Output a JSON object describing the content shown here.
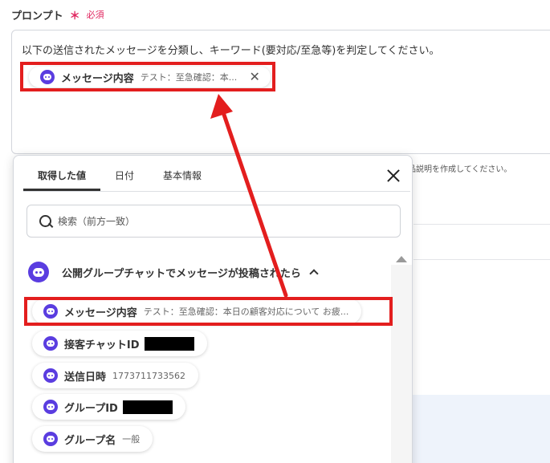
{
  "field": {
    "label": "プロンプト",
    "required_mark": "＊",
    "required_text": "必須",
    "prompt_text": "以下の送信されたメッセージを分類し、キーワード(要対応/至急等)を判定してください。",
    "inserted_chip": {
      "icon": "chat-bubble-icon",
      "label": "メッセージ内容",
      "value": "テスト：至急確認：本...",
      "close": "✕"
    },
    "background_hint": "品説明を作成してください。"
  },
  "popup": {
    "tabs": [
      "取得した値",
      "日付",
      "基本情報"
    ],
    "active_tab": 0,
    "close_icon": "close-icon",
    "search": {
      "placeholder": "検索（前方一致）"
    },
    "group": {
      "title": "公開グループチャットでメッセージが投稿されたら",
      "icon": "chat-bubble-icon",
      "expanded": true
    },
    "items": [
      {
        "label": "メッセージ内容",
        "value": "テスト：至急確認：本日の顧客対応について お疲...",
        "redacted": false
      },
      {
        "label": "接客チャットID",
        "value": "",
        "redacted": true
      },
      {
        "label": "送信日時",
        "value": "1773711733562",
        "redacted": false
      },
      {
        "label": "グループID",
        "value": "",
        "redacted": true
      },
      {
        "label": "グループ名",
        "value": "一般",
        "redacted": false
      }
    ]
  },
  "annotation": {
    "highlight_color": "#e31e1e",
    "accent_color": "#5a3de0"
  }
}
